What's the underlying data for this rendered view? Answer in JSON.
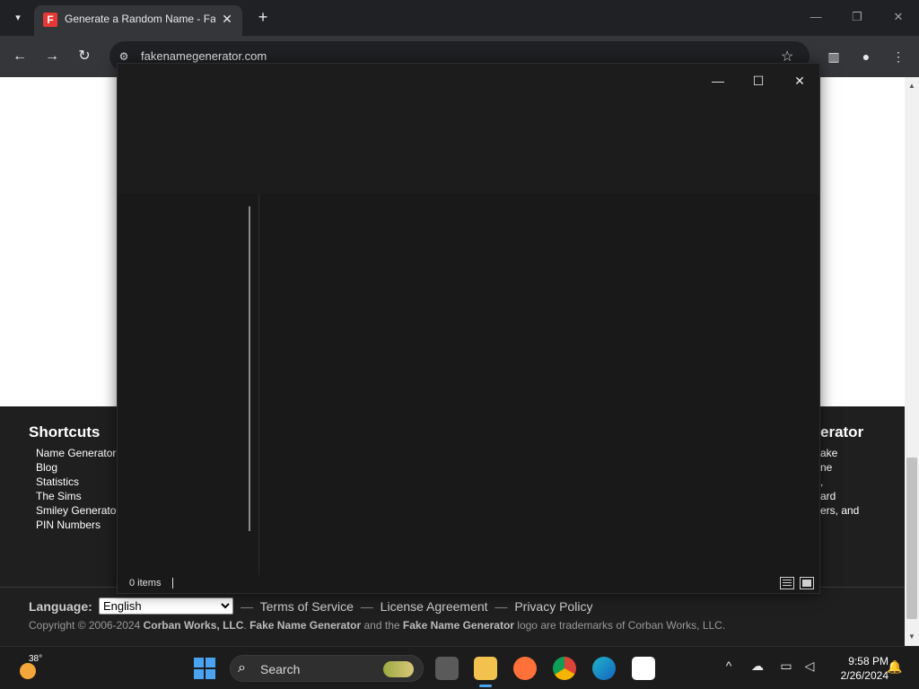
{
  "browser": {
    "tab_title": "Generate a Random Name - Fake Name Generator",
    "tab_favicon_letter": "F",
    "url": "fakenamegenerator.com"
  },
  "website": {
    "shortcuts_title": "Shortcuts",
    "shortcuts": [
      "Name Generator",
      "Blog",
      "Statistics",
      "The Sims",
      "Smiley Generator",
      "PIN Numbers"
    ],
    "right_column_title": "erator",
    "right_column_text": "ake\nne\n,\nard\ners, and",
    "language_label": "Language:",
    "language_selected": "English",
    "links": [
      "Terms of Service",
      "License Agreement",
      "Privacy Policy"
    ],
    "link_separator": "—",
    "copyright_prefix": "Copyright © 2006-2024",
    "copyright_company": "Corban Works, LLC",
    "copyright_mid1": ".",
    "copyright_brand1": "Fake Name Generator",
    "copyright_mid2": "and the",
    "copyright_brand2": "Fake Name Generator",
    "copyright_suffix": "logo are trademarks of Corban Works, LLC."
  },
  "explorer": {
    "status_items": "0 items"
  },
  "taskbar": {
    "weather_temp": "38°",
    "search_label": "Search",
    "time": "9:58 PM",
    "date": "2/26/2024"
  },
  "icons": {
    "tab_search": "chevron-down-icon",
    "close": "close-icon",
    "new_tab": "plus-icon",
    "back": "arrow-left-icon",
    "forward": "arrow-right-icon",
    "reload": "reload-icon",
    "bookmark": "star-icon"
  },
  "colors": {
    "chrome_dark": "#202124",
    "toolbar": "#35363a",
    "explorer_bg": "#191919",
    "footer_bg": "#1f1f1f",
    "accent": "#4aa3f0"
  }
}
